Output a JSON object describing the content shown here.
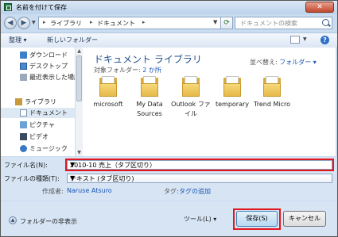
{
  "window": {
    "title": "名前を付けて保存",
    "close_label": "✕"
  },
  "address": {
    "crumbs": [
      "ライブラリ",
      "ドキュメント"
    ],
    "search_placeholder": "ドキュメントの検索"
  },
  "toolbar": {
    "organize": "整理 ▾",
    "new_folder": "新しいフォルダー"
  },
  "nav_pane": {
    "items": [
      {
        "label": "ダウンロード",
        "icon": "download-folder-icon"
      },
      {
        "label": "デスクトップ",
        "icon": "desktop-icon"
      },
      {
        "label": "最近表示した場所",
        "icon": "recent-places-icon"
      },
      {
        "label": "ライブラリ",
        "icon": "libraries-icon"
      },
      {
        "label": "ドキュメント",
        "icon": "documents-icon",
        "selected": true
      },
      {
        "label": "ピクチャ",
        "icon": "pictures-icon"
      },
      {
        "label": "ビデオ",
        "icon": "videos-icon"
      },
      {
        "label": "ミュージック",
        "icon": "music-icon"
      }
    ]
  },
  "content": {
    "library_title": "ドキュメント ライブラリ",
    "target_label": "対象フォルダー: ",
    "target_link": "2 か所",
    "arrange_label": "並べ替え: ",
    "arrange_value": "フォルダー ▾",
    "folders": [
      {
        "label": "microsoft"
      },
      {
        "label": "My Data Sources"
      },
      {
        "label": "Outlook ファイル"
      },
      {
        "label": "temporary"
      },
      {
        "label": "Trend Micro"
      }
    ]
  },
  "fields": {
    "filename_label": "ファイル名(N):",
    "filename_value": "2010-10 売上（タブ区切り）",
    "filetype_label": "ファイルの種類(T):",
    "filetype_value": "テキスト (タブ区切り)",
    "author_label": "作成者:",
    "author_value": "Naruse Atsuro",
    "tags_label": "タグ:",
    "tags_value": "タグの追加"
  },
  "footer": {
    "hide_folders": "フォルダーの非表示",
    "tools": "ツール(L) ▾",
    "save": "保存(S)",
    "cancel": "キャンセル"
  },
  "colors": {
    "highlight": "#e3161e",
    "link": "#1a55b4",
    "title": "#1e4f8a"
  }
}
